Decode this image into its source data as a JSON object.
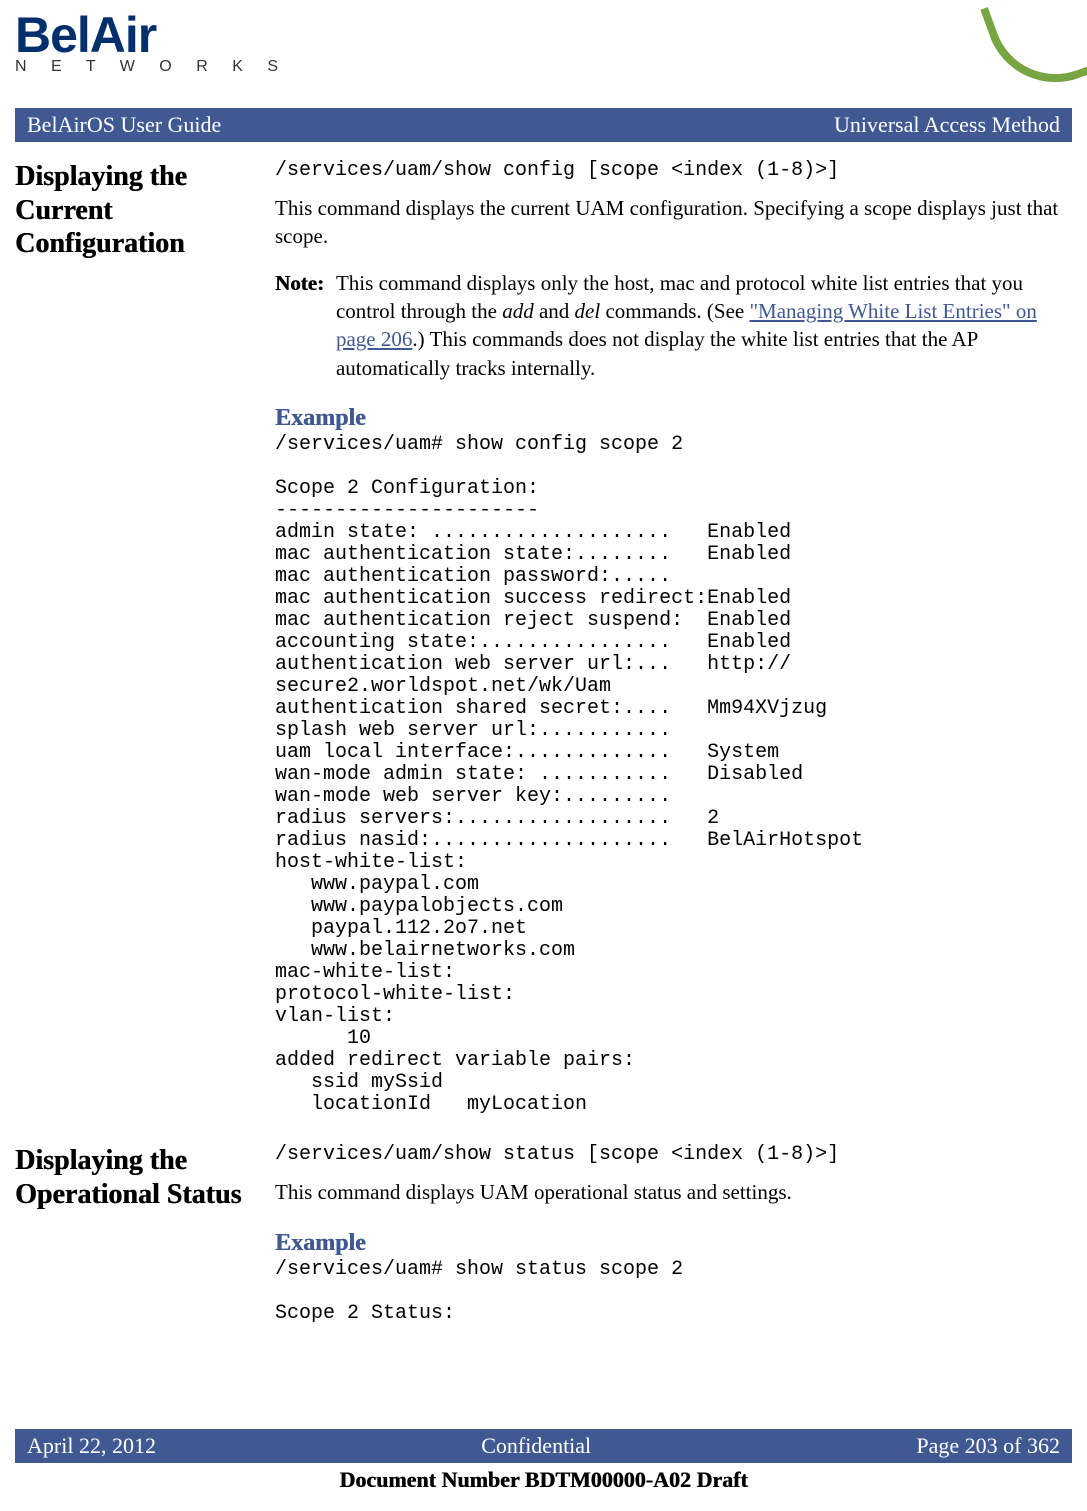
{
  "brand": {
    "name": "BelAir",
    "sub": "N E T W O R K S"
  },
  "titlebar": {
    "left": "BelAirOS User Guide",
    "right": "Universal Access Method"
  },
  "section1": {
    "heading": "Displaying the Current Configuration",
    "cmd": "/services/uam/show config [scope <index (1-8)>]",
    "desc": "This command displays the current UAM configuration. Specifying a scope displays just that scope.",
    "note_label": "Note:",
    "note_pre": "This command displays only the host, mac and protocol white list entries that you control through the ",
    "note_add": "add",
    "note_and": " and ",
    "note_del": "del",
    "note_mid": " commands. (See ",
    "note_link": "\"Managing White List Entries\" on page 206",
    "note_post": ".) This commands does not display the white list entries that the AP automatically tracks internally.",
    "example_label": "Example",
    "example": "/services/uam# show config scope 2\n\nScope 2 Configuration:\n----------------------\nadmin state: ....................   Enabled\nmac authentication state:........   Enabled\nmac authentication password:.....\nmac authentication success redirect:Enabled\nmac authentication reject suspend:  Enabled\naccounting state:................   Enabled\nauthentication web server url:...   http://\nsecure2.worldspot.net/wk/Uam\nauthentication shared secret:....   Mm94XVjzug\nsplash web server url:...........\nuam local interface:.............   System\nwan-mode admin state: ...........   Disabled\nwan-mode web server key:.........\nradius servers:..................   2\nradius nasid:....................   BelAirHotspot\nhost-white-list:\n   www.paypal.com\n   www.paypalobjects.com\n   paypal.112.2o7.net\n   www.belairnetworks.com\nmac-white-list:\nprotocol-white-list:\nvlan-list:\n      10\nadded redirect variable pairs:\n   ssid mySsid\n   locationId   myLocation"
  },
  "section2": {
    "heading": "Displaying the Operational Status",
    "cmd": "/services/uam/show status [scope <index (1-8)>]",
    "desc": "This command displays UAM operational status and settings.",
    "example_label": "Example",
    "example": "/services/uam# show status scope 2\n\nScope 2 Status:"
  },
  "footer": {
    "left": "April 22, 2012",
    "center": "Confidential",
    "right": "Page 203 of 362"
  },
  "docnum": "Document Number BDTM00000-A02 Draft"
}
